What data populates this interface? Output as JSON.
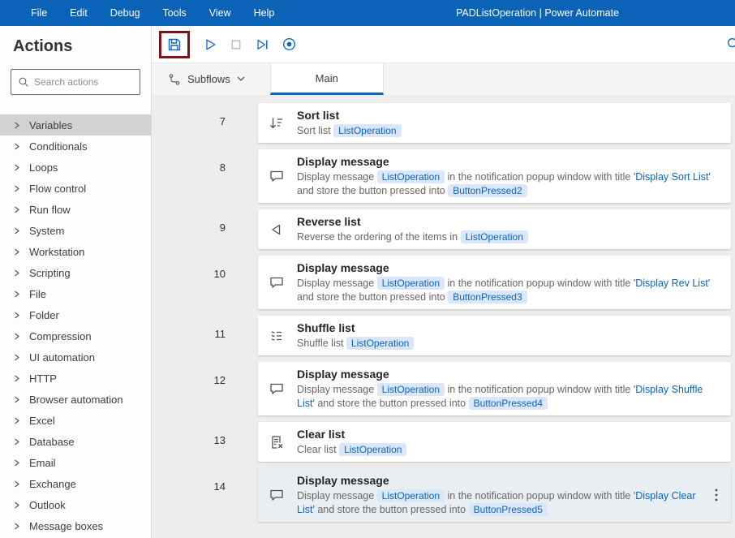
{
  "colors": {
    "accent": "#0b64c0",
    "titlebar_blue": "#0a63b6",
    "pill_bg": "#d9e7f9",
    "annotation_red": "#7e1416",
    "selected_row_bg": "#e9eef3",
    "sidebar_selected_bg": "#d2d2d2"
  },
  "menubar": {
    "items": [
      "File",
      "Edit",
      "Debug",
      "Tools",
      "View",
      "Help"
    ],
    "title": "PADListOperation | Power Automate"
  },
  "sidebar": {
    "title": "Actions",
    "search_placeholder": "Search actions",
    "categories": [
      {
        "label": "Variables",
        "selected": true
      },
      {
        "label": "Conditionals",
        "selected": false
      },
      {
        "label": "Loops",
        "selected": false
      },
      {
        "label": "Flow control",
        "selected": false
      },
      {
        "label": "Run flow",
        "selected": false
      },
      {
        "label": "System",
        "selected": false
      },
      {
        "label": "Workstation",
        "selected": false
      },
      {
        "label": "Scripting",
        "selected": false
      },
      {
        "label": "File",
        "selected": false
      },
      {
        "label": "Folder",
        "selected": false
      },
      {
        "label": "Compression",
        "selected": false
      },
      {
        "label": "UI automation",
        "selected": false
      },
      {
        "label": "HTTP",
        "selected": false
      },
      {
        "label": "Browser automation",
        "selected": false
      },
      {
        "label": "Excel",
        "selected": false
      },
      {
        "label": "Database",
        "selected": false
      },
      {
        "label": "Email",
        "selected": false
      },
      {
        "label": "Exchange",
        "selected": false
      },
      {
        "label": "Outlook",
        "selected": false
      },
      {
        "label": "Message boxes",
        "selected": false
      }
    ]
  },
  "toolbar": {
    "buttons": [
      {
        "name": "save",
        "highlighted": true,
        "disabled": false
      },
      {
        "name": "run",
        "highlighted": false,
        "disabled": false
      },
      {
        "name": "stop",
        "highlighted": false,
        "disabled": true
      },
      {
        "name": "run-next-action",
        "highlighted": false,
        "disabled": false
      },
      {
        "name": "record",
        "highlighted": false,
        "disabled": false
      }
    ]
  },
  "tabs": {
    "subflows_label": "Subflows",
    "tabs": [
      {
        "label": "Main",
        "active": true
      }
    ]
  },
  "workflow": {
    "rows": [
      {
        "number": "7",
        "icon": "sort-list",
        "title": "Sort list",
        "selected": false,
        "desc": [
          {
            "t": "text",
            "v": "Sort list "
          },
          {
            "t": "pill",
            "v": "ListOperation"
          }
        ]
      },
      {
        "number": "8",
        "icon": "display-message",
        "title": "Display message",
        "selected": false,
        "desc": [
          {
            "t": "text",
            "v": "Display message "
          },
          {
            "t": "pill",
            "v": "ListOperation"
          },
          {
            "t": "text",
            "v": " in the notification popup window with title "
          },
          {
            "t": "blue",
            "v": "'Display Sort List'"
          },
          {
            "t": "text",
            "v": " and store the button pressed into "
          },
          {
            "t": "pill",
            "v": "ButtonPressed2"
          }
        ]
      },
      {
        "number": "9",
        "icon": "reverse-list",
        "title": "Reverse list",
        "selected": false,
        "desc": [
          {
            "t": "text",
            "v": "Reverse the ordering of the items in "
          },
          {
            "t": "pill",
            "v": "ListOperation"
          }
        ]
      },
      {
        "number": "10",
        "icon": "display-message",
        "title": "Display message",
        "selected": false,
        "desc": [
          {
            "t": "text",
            "v": "Display message "
          },
          {
            "t": "pill",
            "v": "ListOperation"
          },
          {
            "t": "text",
            "v": " in the notification popup window with title "
          },
          {
            "t": "blue",
            "v": "'Display Rev List'"
          },
          {
            "t": "text",
            "v": " and store the button pressed into "
          },
          {
            "t": "pill",
            "v": "ButtonPressed3"
          }
        ]
      },
      {
        "number": "11",
        "icon": "shuffle-list",
        "title": "Shuffle list",
        "selected": false,
        "desc": [
          {
            "t": "text",
            "v": "Shuffle list "
          },
          {
            "t": "pill",
            "v": "ListOperation"
          }
        ]
      },
      {
        "number": "12",
        "icon": "display-message",
        "title": "Display message",
        "selected": false,
        "desc": [
          {
            "t": "text",
            "v": "Display message "
          },
          {
            "t": "pill",
            "v": "ListOperation"
          },
          {
            "t": "text",
            "v": " in the notification popup window with title "
          },
          {
            "t": "blue",
            "v": "'Display Shuffle List'"
          },
          {
            "t": "text",
            "v": " and store the button pressed into "
          },
          {
            "t": "pill",
            "v": "ButtonPressed4"
          }
        ]
      },
      {
        "number": "13",
        "icon": "clear-list",
        "title": "Clear list",
        "selected": false,
        "desc": [
          {
            "t": "text",
            "v": "Clear list "
          },
          {
            "t": "pill",
            "v": "ListOperation"
          }
        ]
      },
      {
        "number": "14",
        "icon": "display-message",
        "title": "Display message",
        "selected": true,
        "menu": "kebab",
        "desc": [
          {
            "t": "text",
            "v": "Display message "
          },
          {
            "t": "pill",
            "v": "ListOperation"
          },
          {
            "t": "text",
            "v": " in the notification popup window with title "
          },
          {
            "t": "blue",
            "v": "'Display Clear List'"
          },
          {
            "t": "text",
            "v": " and store the button pressed into "
          },
          {
            "t": "pill",
            "v": "ButtonPressed5"
          }
        ]
      }
    ]
  }
}
